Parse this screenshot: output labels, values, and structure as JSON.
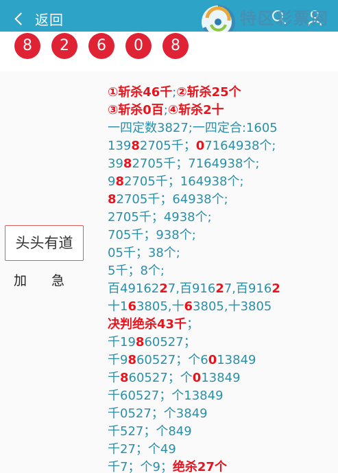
{
  "header": {
    "back_label": "返回",
    "logo_name": "特区彩票网",
    "logo_url": "www.tqcp.net"
  },
  "balls": [
    "8",
    "2",
    "6",
    "0",
    "8"
  ],
  "sidebar": {
    "tag": "头头有道",
    "urgent": "加急"
  },
  "content": {
    "lines": [
      [
        [
          "①斩杀46千",
          "r"
        ],
        [
          ";",
          "n"
        ],
        [
          "②斩杀25个",
          "r"
        ]
      ],
      [
        [
          "③斩杀0百",
          "r"
        ],
        [
          ";",
          "n"
        ],
        [
          "④斩杀2十",
          "r"
        ]
      ],
      [
        [
          "一四定数3827;一四定合:1605",
          "n"
        ]
      ],
      [
        [
          "139",
          "n"
        ],
        [
          "8",
          "r"
        ],
        [
          "2705千；",
          "n"
        ],
        [
          "0",
          "r"
        ],
        [
          "7164938个;",
          "n"
        ]
      ],
      [
        [
          "39",
          "n"
        ],
        [
          "8",
          "r"
        ],
        [
          "2705千；7164938个;",
          "n"
        ]
      ],
      [
        [
          "9",
          "n"
        ],
        [
          "8",
          "r"
        ],
        [
          "2705千；164938个;",
          "n"
        ]
      ],
      [
        [
          "8",
          "r"
        ],
        [
          "2705千；64938个;",
          "n"
        ]
      ],
      [
        [
          "2705千；4938个;",
          "n"
        ]
      ],
      [
        [
          "705千；938个;",
          "n"
        ]
      ],
      [
        [
          "05千；38个;",
          "n"
        ]
      ],
      [
        [
          "5千；8个;",
          "n"
        ]
      ],
      [
        [
          "百49162",
          "n"
        ],
        [
          "2",
          "r"
        ],
        [
          "7,百916",
          "n"
        ],
        [
          "2",
          "r"
        ],
        [
          "7,百916",
          "n"
        ],
        [
          "2",
          "r"
        ]
      ],
      [
        [
          "十1",
          "n"
        ],
        [
          "6",
          "r"
        ],
        [
          "3805,十",
          "n"
        ],
        [
          "6",
          "r"
        ],
        [
          "3805,十3805",
          "n"
        ]
      ],
      [
        [
          "决判绝杀43千",
          "r"
        ],
        [
          "；",
          "n"
        ]
      ],
      [
        [
          "千19",
          "n"
        ],
        [
          "8",
          "r"
        ],
        [
          "60527；",
          "n"
        ]
      ],
      [
        [
          "千9",
          "n"
        ],
        [
          "8",
          "r"
        ],
        [
          "60527；个6",
          "n"
        ],
        [
          "0",
          "r"
        ],
        [
          "13849",
          "n"
        ]
      ],
      [
        [
          "千",
          "n"
        ],
        [
          "8",
          "r"
        ],
        [
          "60527；个",
          "n"
        ],
        [
          "0",
          "r"
        ],
        [
          "13849",
          "n"
        ]
      ],
      [
        [
          "千60527；个13849",
          "n"
        ]
      ],
      [
        [
          "千0527；个3849",
          "n"
        ]
      ],
      [
        [
          "千527；个849",
          "n"
        ]
      ],
      [
        [
          "千27；个49",
          "n"
        ]
      ],
      [
        [
          "千7；个9；",
          "n"
        ],
        [
          "绝杀27个",
          "r"
        ]
      ]
    ]
  }
}
